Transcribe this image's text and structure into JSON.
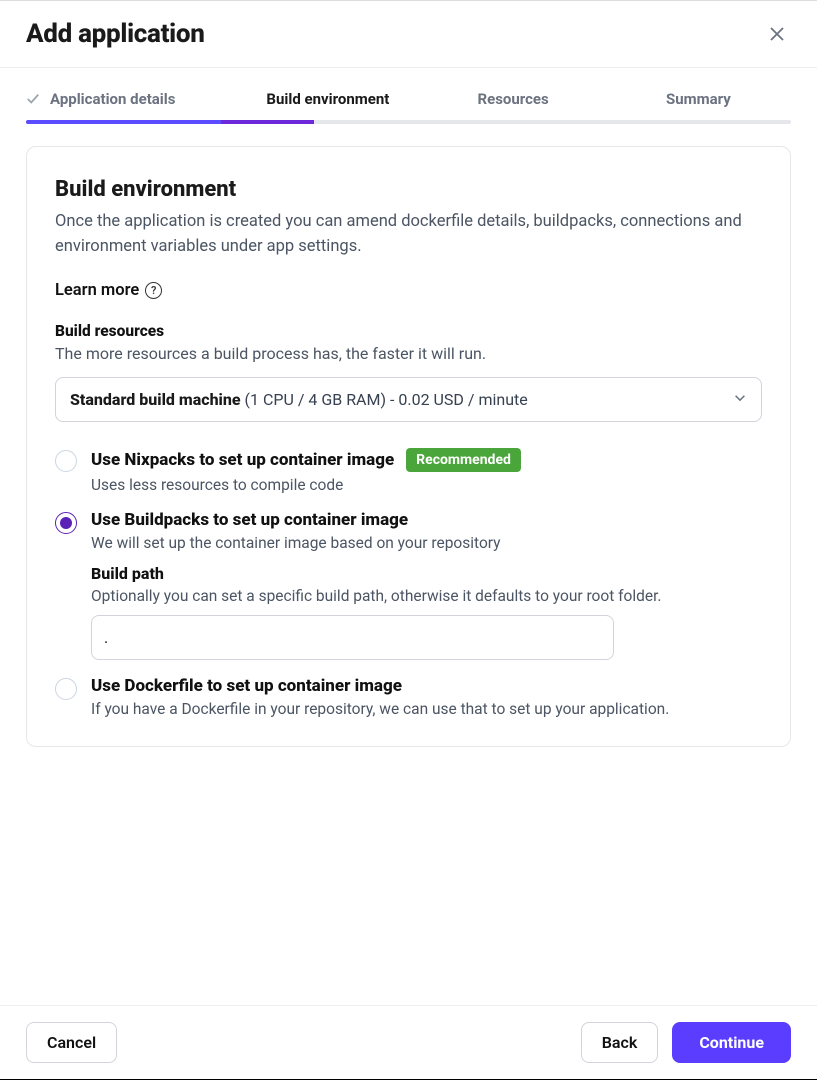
{
  "header": {
    "title": "Add application"
  },
  "steps": [
    {
      "label": "Application details",
      "state": "done"
    },
    {
      "label": "Build environment",
      "state": "active"
    },
    {
      "label": "Resources",
      "state": "pending"
    },
    {
      "label": "Summary",
      "state": "pending"
    }
  ],
  "main": {
    "heading": "Build environment",
    "description": "Once the application is created you can amend dockerfile details, buildpacks, connections and environment variables under app settings.",
    "learn_more": "Learn more",
    "build_resources": {
      "label": "Build resources",
      "description": "The more resources a build process has, the faster it will run.",
      "selected_name": "Standard build machine",
      "selected_detail": " (1 CPU / 4 GB RAM) - 0.02 USD / minute"
    },
    "options": {
      "nixpacks": {
        "title": "Use Nixpacks to set up container image",
        "badge": "Recommended",
        "description": "Uses less resources to compile code",
        "selected": false
      },
      "buildpacks": {
        "title": "Use Buildpacks to set up container image",
        "description": "We will set up the container image based on your repository",
        "selected": true,
        "build_path": {
          "label": "Build path",
          "description": "Optionally you can set a specific build path, otherwise it defaults to your root folder.",
          "value": "."
        }
      },
      "dockerfile": {
        "title": "Use Dockerfile to set up container image",
        "description": "If you have a Dockerfile in your repository, we can use that to set up your application.",
        "selected": false
      }
    }
  },
  "footer": {
    "cancel": "Cancel",
    "back": "Back",
    "continue": "Continue"
  }
}
